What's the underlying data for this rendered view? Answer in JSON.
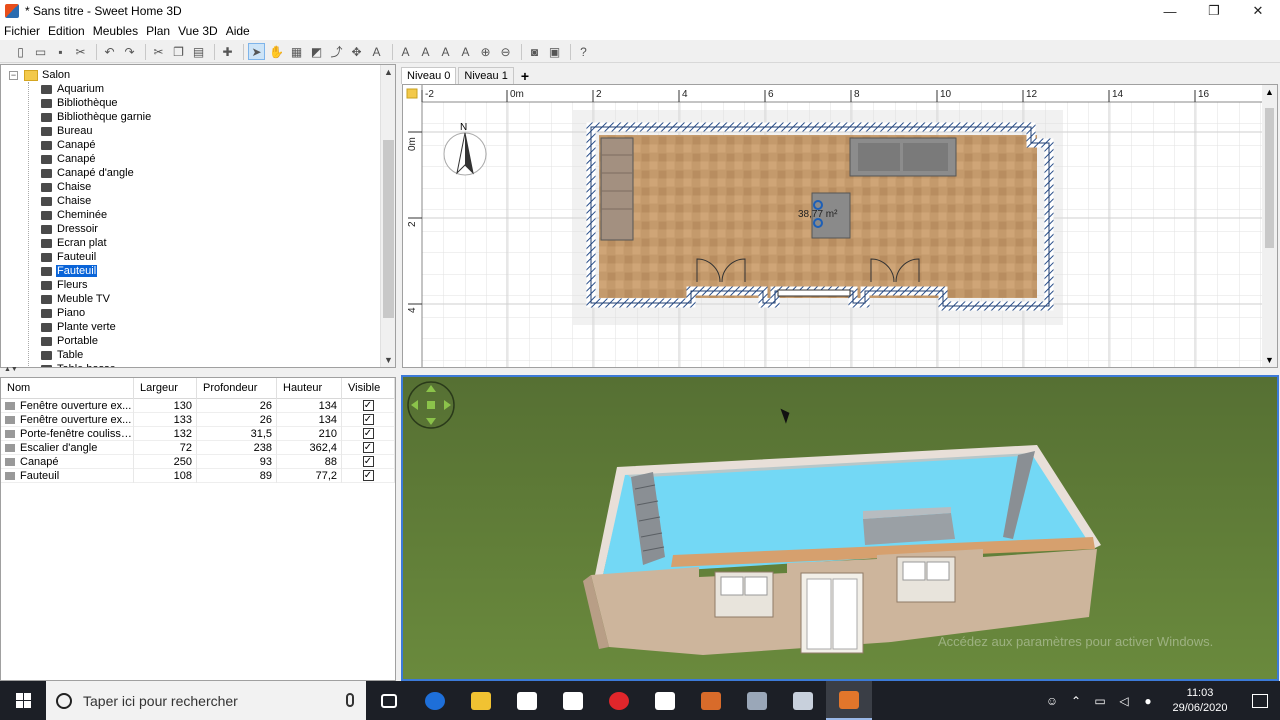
{
  "window": {
    "title": "* Sans titre - Sweet Home 3D",
    "minimize": "—",
    "maximize": "❐",
    "close": "✕"
  },
  "menu": [
    "Fichier",
    "Edition",
    "Meubles",
    "Plan",
    "Vue 3D",
    "Aide"
  ],
  "toolbar": {
    "icons": [
      "new-icon",
      "open-icon",
      "save-icon",
      "cut-icon",
      "sep",
      "undo-icon",
      "redo-icon",
      "sep",
      "scissors-icon",
      "copy-icon",
      "paste-icon",
      "sep",
      "add-furniture-icon",
      "sep",
      "select-icon",
      "pan-icon",
      "create-walls-icon",
      "create-rooms-icon",
      "create-polylines-icon",
      "create-dimensions-icon",
      "add-text-icon",
      "sep",
      "text-style-icon",
      "text-style-icon",
      "text-style-icon",
      "text-style-icon",
      "zoom-in-icon",
      "zoom-out-icon",
      "sep",
      "photo-icon",
      "video-icon",
      "sep",
      "help-icon"
    ]
  },
  "catalog": {
    "root": "Salon",
    "items": [
      "Aquarium",
      "Bibliothèque",
      "Bibliothèque garnie",
      "Bureau",
      "Canapé",
      "Canapé",
      "Canapé d'angle",
      "Chaise",
      "Chaise",
      "Cheminée",
      "Dressoir",
      "Ecran plat",
      "Fauteuil",
      "Fauteuil",
      "Fleurs",
      "Meuble TV",
      "Piano",
      "Plante verte",
      "Portable",
      "Table",
      "Table basse"
    ],
    "selected_index": 13
  },
  "furniture_table": {
    "headers": [
      "Nom",
      "Largeur",
      "Profondeur",
      "Hauteur",
      "Visible"
    ],
    "rows": [
      {
        "name": "Fenêtre ouverture ex...",
        "width": "130",
        "depth": "26",
        "height": "134",
        "visible": "✓"
      },
      {
        "name": "Fenêtre ouverture ex...",
        "width": "133",
        "depth": "26",
        "height": "134",
        "visible": "✓"
      },
      {
        "name": "Porte-fenêtre coulissa...",
        "width": "132",
        "depth": "31,5",
        "height": "210",
        "visible": "✓"
      },
      {
        "name": "Escalier d'angle",
        "width": "72",
        "depth": "238",
        "height": "362,4",
        "visible": "✓"
      },
      {
        "name": "Canapé",
        "width": "250",
        "depth": "93",
        "height": "88",
        "visible": "✓"
      },
      {
        "name": "Fauteuil",
        "width": "108",
        "depth": "89",
        "height": "77,2",
        "visible": "✓"
      }
    ]
  },
  "plan": {
    "tabs": [
      "Niveau 0",
      "Niveau 1"
    ],
    "add_tab": "+",
    "ruler_x": [
      "-2",
      "0m",
      "2",
      "4",
      "6",
      "8",
      "10",
      "12",
      "14",
      "16"
    ],
    "ruler_y": [
      "0m",
      "2",
      "4"
    ],
    "compass_label": "N",
    "room_area": "38,77 m²"
  },
  "view3d": {
    "watermark": "Accédez aux paramètres pour activer Windows."
  },
  "taskbar": {
    "search_placeholder": "Taper ici pour rechercher",
    "time": "11:03",
    "date": "29/06/2020",
    "apps": [
      {
        "name": "task-view-icon",
        "color": "#1c1f26"
      },
      {
        "name": "edge-icon",
        "color": "#1e6fd9"
      },
      {
        "name": "explorer-icon",
        "color": "#f1c232"
      },
      {
        "name": "store-icon",
        "color": "#ffffff"
      },
      {
        "name": "camera-icon",
        "color": "#ffffff"
      },
      {
        "name": "opera-icon",
        "color": "#e0262b"
      },
      {
        "name": "mail-icon",
        "color": "#ffffff"
      },
      {
        "name": "app-icon",
        "color": "#d86b2a"
      },
      {
        "name": "app-icon",
        "color": "#9aa7b8"
      },
      {
        "name": "app-icon",
        "color": "#c8d0dc"
      },
      {
        "name": "sweethome3d-icon",
        "color": "#e2762b"
      }
    ]
  }
}
